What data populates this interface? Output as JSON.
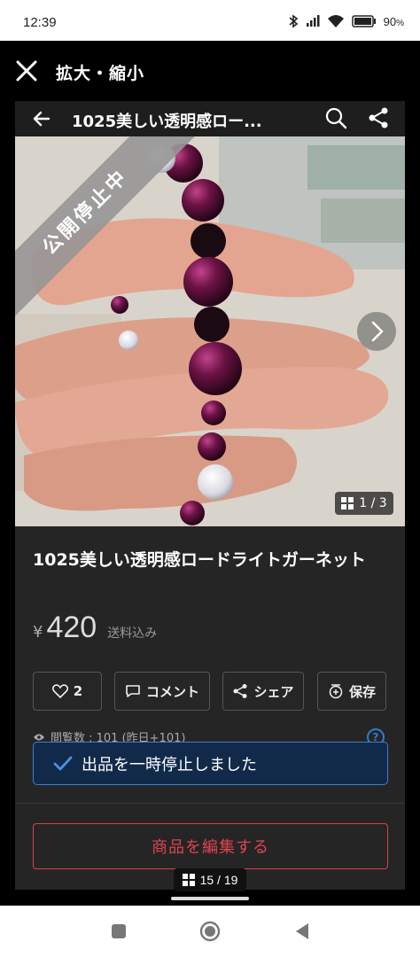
{
  "status_bar": {
    "time": "12:39",
    "battery": "90",
    "battery_unit": "%"
  },
  "viewer": {
    "title": "拡大・縮小",
    "close_icon": "close-icon"
  },
  "app_bar": {
    "title": "1025美しい透明感ロー...",
    "back_icon": "arrow-left-icon",
    "search_icon": "search-icon",
    "share_icon": "share-icon"
  },
  "photo": {
    "banner": "公開停止中",
    "counter": "1 / 3"
  },
  "product": {
    "title": "1025美しい透明感ロードライトガーネット",
    "currency": "¥",
    "price": "420",
    "shipping": "送料込み"
  },
  "actions": {
    "like_count": "2",
    "comment": "コメント",
    "share": "シェア",
    "save": "保存"
  },
  "stats": {
    "views": "閲覧数 : 101 (昨日+101)"
  },
  "toast": {
    "message": "出品を一時停止しました"
  },
  "edit": {
    "label": "商品を編集する"
  },
  "pager": {
    "label": "15 / 19"
  },
  "colors": {
    "accent_red": "#e0444e",
    "toast_blue": "#3a7fd0",
    "dark_bg": "#252525"
  }
}
